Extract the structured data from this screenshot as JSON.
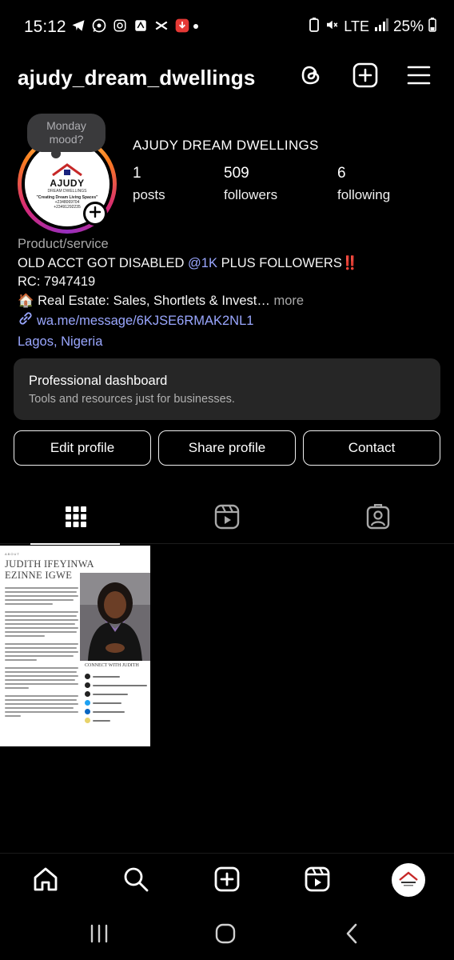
{
  "status_bar": {
    "time": "15:12",
    "network": "LTE",
    "battery": "25%"
  },
  "header": {
    "username": "ajudy_dream_dwellings"
  },
  "profile": {
    "note": "Monday mood?",
    "display_name": "AJUDY DREAM DWELLINGS",
    "avatar_brand": "AJUDY",
    "avatar_sub": "DREAM DWELLINGS",
    "avatar_slogan": "\"Creating Dream Living Spaces\"",
    "avatar_phone_1": "+2348069704",
    "avatar_phone_2": "+23491292235",
    "stats": [
      {
        "value": "1",
        "label": "posts"
      },
      {
        "value": "509",
        "label": "followers"
      },
      {
        "value": "6",
        "label": "following"
      }
    ]
  },
  "bio": {
    "category": "Product/service",
    "line1_before": "OLD ACCT GOT DISABLED ",
    "line1_mention": "@1K",
    "line1_after": " PLUS FOLLOWERS",
    "line1_emoji": "‼️",
    "line2": "RC: 7947419",
    "line3_emoji": "🏠",
    "line3": "Real Estate: Sales, Shortlets & Invest…",
    "more": "more",
    "link": "wa.me/message/6KJSE6RMAK2NL1",
    "location": "Lagos, Nigeria"
  },
  "dashboard": {
    "title": "Professional dashboard",
    "subtitle": "Tools and resources just for businesses."
  },
  "buttons": {
    "edit": "Edit profile",
    "share": "Share profile",
    "contact": "Contact"
  },
  "post": {
    "about": "ABOUT",
    "name_line1": "JUDITH IFEYINWA",
    "name_line2": "EZINNE IGWE",
    "contact_title": "CONNECT WITH JUDITH"
  },
  "colors": {
    "background": "#000000",
    "link": "#9aa7ff",
    "muted": "#a8a8a8",
    "card": "#262626"
  }
}
